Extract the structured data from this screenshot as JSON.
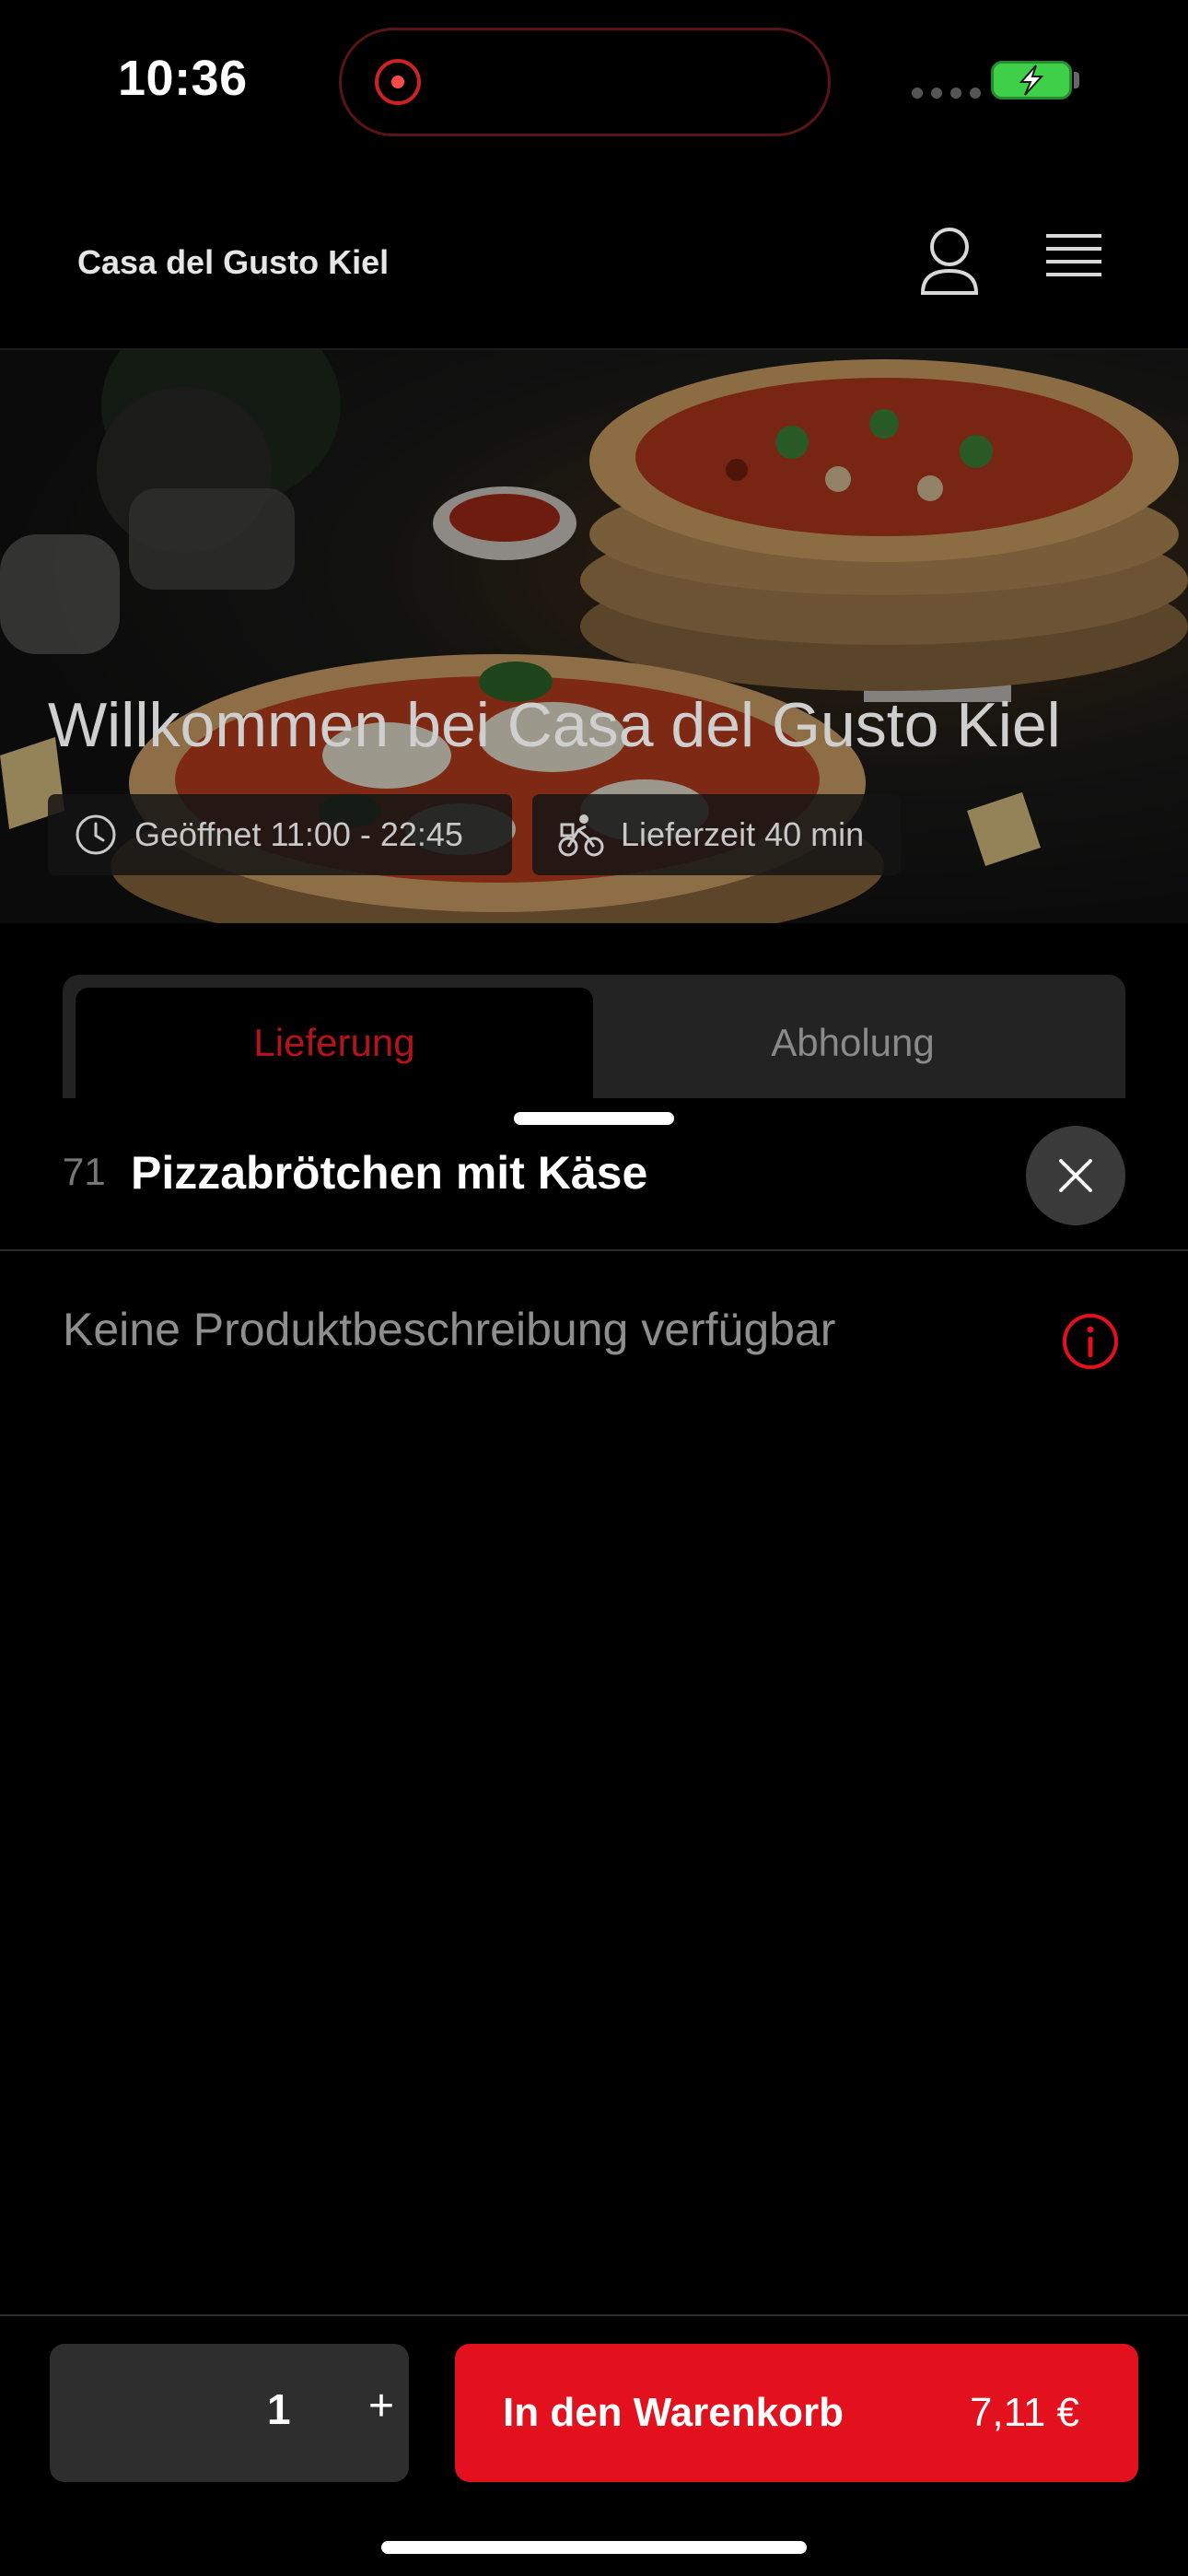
{
  "status_bar": {
    "time": "10:36"
  },
  "header": {
    "brand": "Casa del Gusto Kiel"
  },
  "hero": {
    "title": "Willkommen bei Casa del Gusto Kiel",
    "opening_hours": "Geöffnet 11:00 - 22:45",
    "delivery_time": "Lieferzeit 40 min"
  },
  "tabs": [
    {
      "label": "Lieferung",
      "selected": true
    },
    {
      "label": "Abholung",
      "selected": false
    }
  ],
  "product": {
    "number": "71",
    "name": "Pizzabrötchen mit Käse",
    "description": "Keine Produktbeschreibung verfügbar"
  },
  "cart": {
    "quantity": "1",
    "plus_label": "+",
    "add_label": "In den Warenkorb",
    "price": "7,11 €"
  },
  "colors": {
    "accent": "#e3101d",
    "tab_selected_text": "#b5121b",
    "battery": "#3fd04a"
  },
  "icons": [
    "user-icon",
    "menu-icon",
    "clock-icon",
    "bicycle-icon",
    "close-icon",
    "info-icon",
    "record-icon",
    "battery-icon"
  ]
}
